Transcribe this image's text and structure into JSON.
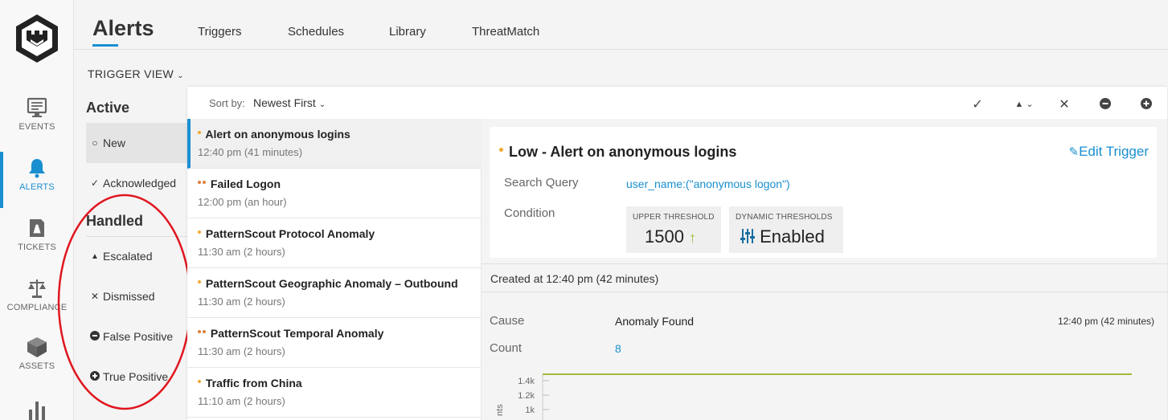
{
  "nav": {
    "items": [
      {
        "label": "EVENTS",
        "icon": "monitor-icon"
      },
      {
        "label": "ALERTS",
        "icon": "bell-icon"
      },
      {
        "label": "TICKETS",
        "icon": "ticket-icon"
      },
      {
        "label": "COMPLIANCE",
        "icon": "scales-icon"
      },
      {
        "label": "ASSETS",
        "icon": "cube-icon"
      }
    ]
  },
  "header": {
    "title": "Alerts",
    "tabs": [
      "Triggers",
      "Schedules",
      "Library",
      "ThreatMatch"
    ]
  },
  "trigger_view": "TRIGGER VIEW",
  "filters": {
    "active_heading": "Active",
    "active": [
      {
        "label": "New",
        "glyph": "○"
      },
      {
        "label": "Acknowledged",
        "glyph": "✓"
      }
    ],
    "handled_heading": "Handled",
    "handled": [
      {
        "label": "Escalated",
        "glyph": "▲"
      },
      {
        "label": "Dismissed",
        "glyph": "✕"
      },
      {
        "label": "False Positive",
        "glyph": "●"
      },
      {
        "label": "True Positive",
        "glyph": "●"
      }
    ]
  },
  "sort": {
    "label": "Sort by:",
    "value": "Newest First"
  },
  "toolbar": {
    "check": "✓",
    "warn": "▲",
    "close": "✕"
  },
  "alerts": [
    {
      "title": "Alert on anonymous logins",
      "time": "12:40 pm (41 minutes)",
      "dots": 1
    },
    {
      "title": "Failed Logon",
      "time": "12:00 pm (an hour)",
      "dots": 2
    },
    {
      "title": "PatternScout Protocol Anomaly",
      "time": "11:30 am (2 hours)",
      "dots": 1
    },
    {
      "title": "PatternScout Geographic Anomaly – Outbound",
      "time": "11:30 am (2 hours)",
      "dots": 1
    },
    {
      "title": "PatternScout Temporal Anomaly",
      "time": "11:30 am (2 hours)",
      "dots": 2
    },
    {
      "title": "Traffic from China",
      "time": "11:10 am (2 hours)",
      "dots": 1
    }
  ],
  "detail": {
    "title": "Low - Alert on anonymous logins",
    "edit_label": "Edit Trigger",
    "search_query_label": "Search Query",
    "search_query": "user_name:(\"anonymous logon\")",
    "condition_label": "Condition",
    "upper_threshold_label": "UPPER THRESHOLD",
    "upper_threshold_value": "1500",
    "dynamic_label": "DYNAMIC THRESHOLDS",
    "dynamic_value": "Enabled",
    "created": "Created at 12:40 pm (42 minutes)",
    "cause_label": "Cause",
    "cause_value": "Anomaly Found",
    "cause_time": "12:40 pm (42 minutes)",
    "count_label": "Count",
    "count_value": "8"
  },
  "chart_data": {
    "type": "line",
    "y_ticks": [
      "1.4k",
      "1.2k",
      "1k"
    ],
    "ylabel": "nts",
    "series_color": "#a6b83a"
  },
  "colors": {
    "accent": "#1a8fd0",
    "low": "#f0a830",
    "medium": "#e0803a"
  }
}
